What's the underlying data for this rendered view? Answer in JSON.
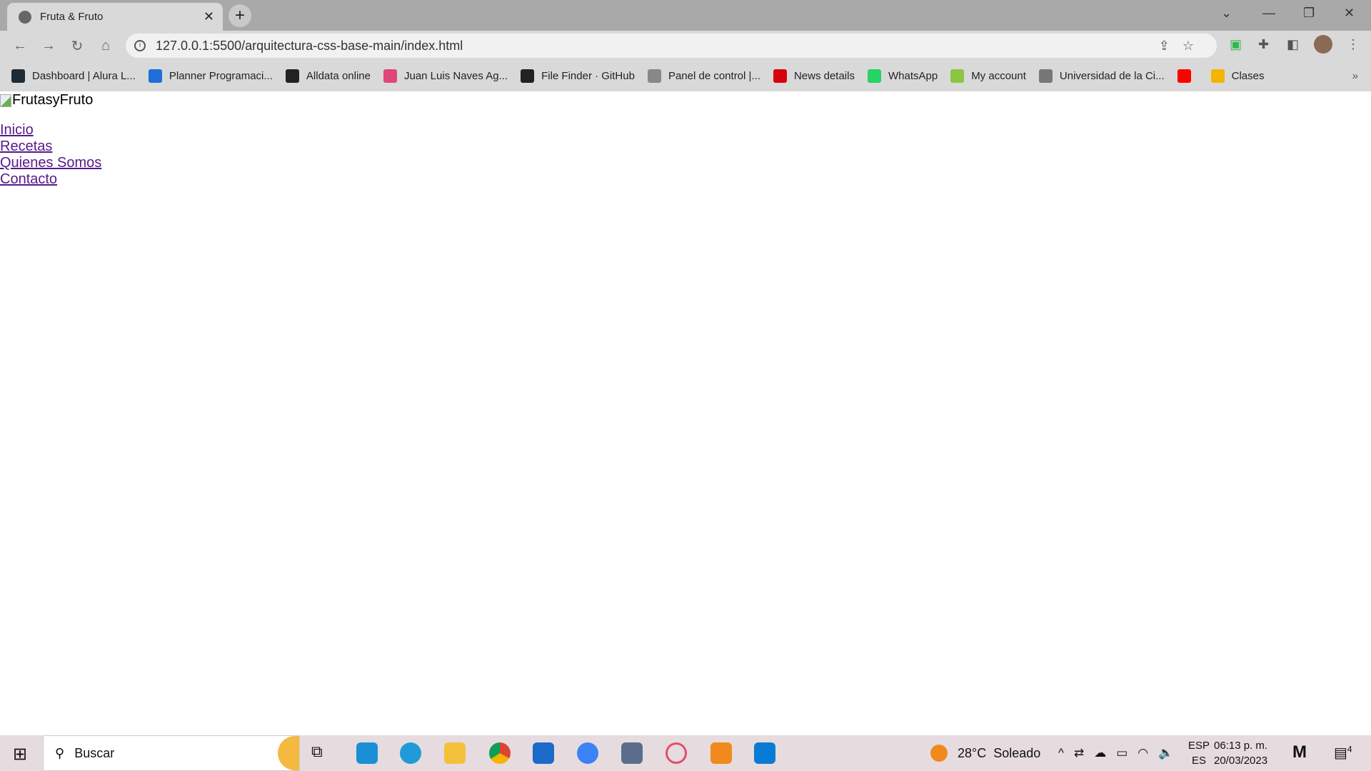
{
  "browser": {
    "tab_title": "Fruta & Fruto",
    "url": "127.0.0.1:5500/arquitectura-css-base-main/index.html",
    "bookmarks": [
      {
        "label": "Dashboard | Alura L...",
        "color": "#1c2b36"
      },
      {
        "label": "Planner Programaci...",
        "color": "#1e6fd9"
      },
      {
        "label": "Alldata online",
        "color": "#222222"
      },
      {
        "label": "Juan Luis Naves Ag...",
        "color": "#e0457b"
      },
      {
        "label": "File Finder · GitHub",
        "color": "#222222"
      },
      {
        "label": "Panel de control |...",
        "color": "#888888"
      },
      {
        "label": "News details",
        "color": "#d7000f"
      },
      {
        "label": "WhatsApp",
        "color": "#25d366"
      },
      {
        "label": "My account",
        "color": "#8cc63f"
      },
      {
        "label": "Universidad de la Ci...",
        "color": "#777777"
      },
      {
        "label": "",
        "color": "#ff0000"
      },
      {
        "label": "Clases",
        "color": "#f4b400"
      }
    ],
    "more": "»"
  },
  "page": {
    "logo_alt": "FrutasyFruto",
    "nav": [
      "Inicio",
      "Recetas",
      "Quienes Somos",
      "Contacto"
    ],
    "link_color": "#551a8b"
  },
  "taskbar": {
    "search_placeholder": "Buscar",
    "weather_temp": "28°C",
    "weather_text": "Soleado",
    "lang_top": "ESP",
    "lang_bottom": "ES",
    "time": "06:13 p. m.",
    "date": "20/03/2023",
    "notifications": "4"
  }
}
